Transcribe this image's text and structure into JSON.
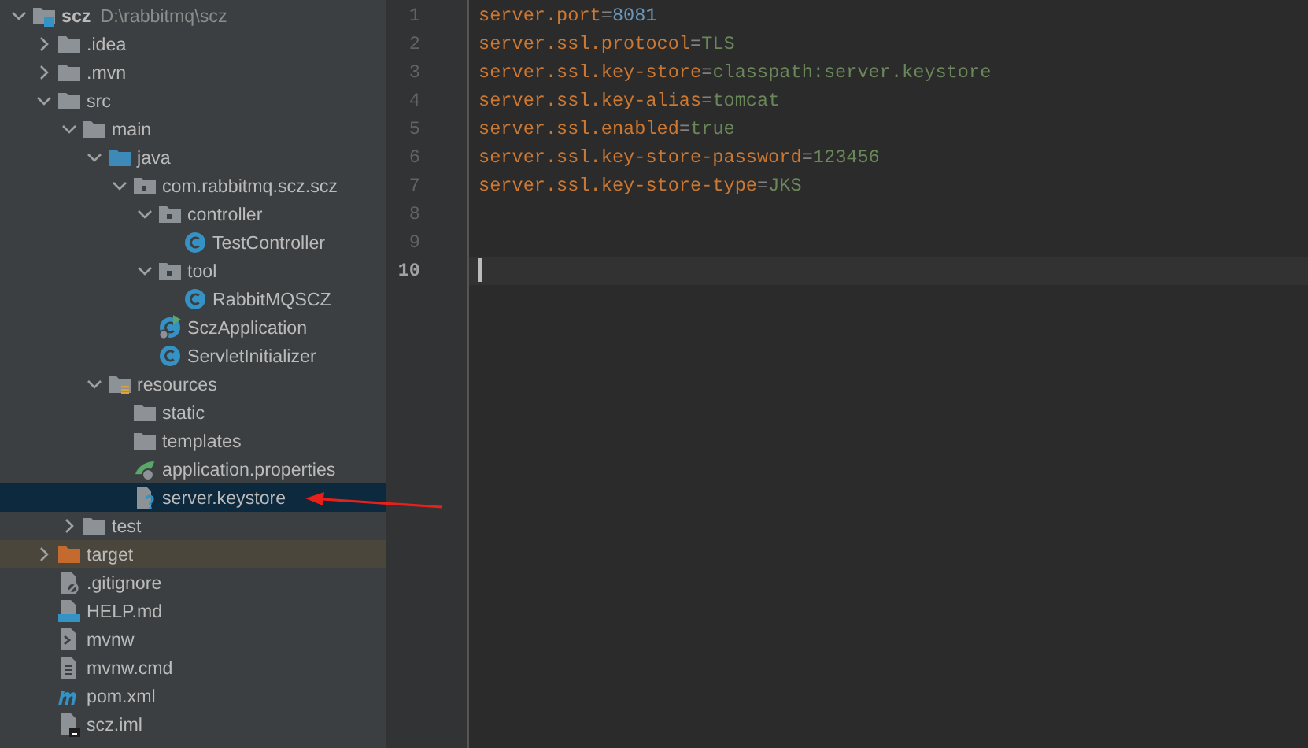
{
  "project_tree": [
    {
      "name": "scz",
      "path": "D:\\rabbitmq\\scz",
      "kind": "project",
      "expanded": true,
      "selected": false,
      "excluded": false,
      "children": [
        {
          "name": ".idea",
          "kind": "folder",
          "expanded": false,
          "selected": false,
          "excluded": false
        },
        {
          "name": ".mvn",
          "kind": "folder",
          "expanded": false,
          "selected": false,
          "excluded": false
        },
        {
          "name": "src",
          "kind": "folder",
          "expanded": true,
          "selected": false,
          "excluded": false,
          "children": [
            {
              "name": "main",
              "kind": "folder",
              "expanded": true,
              "selected": false,
              "excluded": false,
              "children": [
                {
                  "name": "java",
                  "kind": "source-folder",
                  "expanded": true,
                  "selected": false,
                  "excluded": false,
                  "children": [
                    {
                      "name": "com.rabbitmq.scz.scz",
                      "kind": "package",
                      "expanded": true,
                      "selected": false,
                      "excluded": false,
                      "children": [
                        {
                          "name": "controller",
                          "kind": "package",
                          "expanded": true,
                          "selected": false,
                          "excluded": false,
                          "children": [
                            {
                              "name": "TestController",
                              "kind": "class",
                              "selected": false,
                              "excluded": false
                            }
                          ]
                        },
                        {
                          "name": "tool",
                          "kind": "package",
                          "expanded": true,
                          "selected": false,
                          "excluded": false,
                          "children": [
                            {
                              "name": "RabbitMQSCZ",
                              "kind": "class",
                              "selected": false,
                              "excluded": false
                            }
                          ]
                        },
                        {
                          "name": "SczApplication",
                          "kind": "spring-class",
                          "selected": false,
                          "excluded": false
                        },
                        {
                          "name": "ServletInitializer",
                          "kind": "class",
                          "selected": false,
                          "excluded": false
                        }
                      ]
                    }
                  ]
                },
                {
                  "name": "resources",
                  "kind": "resources-folder",
                  "expanded": true,
                  "selected": false,
                  "excluded": false,
                  "children": [
                    {
                      "name": "static",
                      "kind": "folder",
                      "selected": false,
                      "excluded": false
                    },
                    {
                      "name": "templates",
                      "kind": "folder",
                      "selected": false,
                      "excluded": false
                    },
                    {
                      "name": "application.properties",
                      "kind": "properties",
                      "selected": false,
                      "excluded": false
                    },
                    {
                      "name": "server.keystore",
                      "kind": "keystore",
                      "selected": true,
                      "excluded": false
                    }
                  ]
                }
              ]
            },
            {
              "name": "test",
              "kind": "folder",
              "expanded": false,
              "selected": false,
              "excluded": false
            }
          ]
        },
        {
          "name": "target",
          "kind": "excluded-folder",
          "expanded": false,
          "selected": false,
          "excluded": true
        },
        {
          "name": ".gitignore",
          "kind": "ignore-file",
          "selected": false,
          "excluded": false
        },
        {
          "name": "HELP.md",
          "kind": "markdown",
          "selected": false,
          "excluded": false
        },
        {
          "name": "mvnw",
          "kind": "script",
          "selected": false,
          "excluded": false
        },
        {
          "name": "mvnw.cmd",
          "kind": "text-file",
          "selected": false,
          "excluded": false
        },
        {
          "name": "pom.xml",
          "kind": "maven",
          "selected": false,
          "excluded": false
        },
        {
          "name": "scz.iml",
          "kind": "module-file",
          "selected": false,
          "excluded": false
        }
      ]
    }
  ],
  "editor": {
    "lines": [
      {
        "number": "1",
        "key": "server.port",
        "separator": "=",
        "value": "8081",
        "kind": "number",
        "current": false
      },
      {
        "number": "2",
        "key": "server.ssl.protocol",
        "separator": "=",
        "value": "TLS",
        "kind": "string",
        "current": false
      },
      {
        "number": "3",
        "key": "server.ssl.key-store",
        "separator": "=",
        "value": "classpath:server.keystore",
        "kind": "string",
        "current": false
      },
      {
        "number": "4",
        "key": "server.ssl.key-alias",
        "separator": "=",
        "value": "tomcat",
        "kind": "string",
        "current": false
      },
      {
        "number": "5",
        "key": "server.ssl.enabled",
        "separator": "=",
        "value": "true",
        "kind": "string",
        "current": false
      },
      {
        "number": "6",
        "key": "server.ssl.key-store-password",
        "separator": "=",
        "value": "123456",
        "kind": "string",
        "current": false
      },
      {
        "number": "7",
        "key": "server.ssl.key-store-type",
        "separator": "=",
        "value": "JKS",
        "kind": "string",
        "current": false
      },
      {
        "number": "8",
        "current": false
      },
      {
        "number": "9",
        "current": false
      },
      {
        "number": "10",
        "current": true
      }
    ]
  },
  "annotation": {
    "kind": "arrow"
  }
}
